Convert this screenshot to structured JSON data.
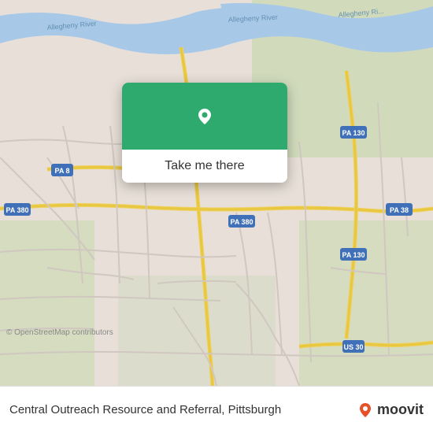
{
  "map": {
    "copyright": "© OpenStreetMap contributors",
    "background_color": "#e8e0d8"
  },
  "popup": {
    "button_label": "Take me there",
    "pin_color": "#ffffff",
    "bg_color": "#2eaa6e"
  },
  "bottom_bar": {
    "place_name": "Central Outreach Resource and Referral, Pittsburgh",
    "moovit_label": "moovit",
    "pin_color": "#e8502a"
  }
}
